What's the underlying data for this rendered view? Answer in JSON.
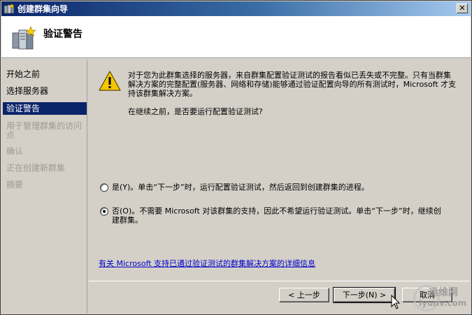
{
  "window": {
    "title": "创建群集向导"
  },
  "header": {
    "title": "验证警告"
  },
  "sidebar": {
    "items": [
      {
        "label": "开始之前",
        "state": "normal"
      },
      {
        "label": "选择服务器",
        "state": "normal"
      },
      {
        "label": "验证警告",
        "state": "active"
      },
      {
        "label": "用于管理群集的访问点",
        "state": "disabled"
      },
      {
        "label": "确认",
        "state": "disabled"
      },
      {
        "label": "正在创建新群集",
        "state": "disabled"
      },
      {
        "label": "摘要",
        "state": "disabled"
      }
    ]
  },
  "main": {
    "warning_text": "对于您为此群集选择的服务器，来自群集配置验证测试的报告看似已丢失或不完整。只有当群集解决方案的完整配置(服务器、网络和存储)能够通过验证配置向导的所有测试时，Microsoft 才支持该群集解决方案。",
    "question": "在继续之前，是否要运行配置验证测试?",
    "options": [
      {
        "label": "是(Y)。单击“下一步”时，运行配置验证测试，然后返回到创建群集的进程。",
        "checked": false
      },
      {
        "label": "否(O)。不需要 Microsoft 对该群集的支持，因此不希望运行验证测试。单击“下一步”时，继续创建群集。",
        "checked": true
      }
    ],
    "link": "有关 Microsoft 支持已通过验证测试的群集解决方案的详细信息"
  },
  "buttons": {
    "back": "< 上一步",
    "next": "下一步(N) >",
    "cancel": "取消"
  },
  "watermark": {
    "line1": "运维网",
    "line2": "iyunv.com"
  },
  "colors": {
    "titlebar_start": "#0a246a",
    "active_step": "#0a246a",
    "link": "#0000cc",
    "warning": "#f6c700"
  }
}
